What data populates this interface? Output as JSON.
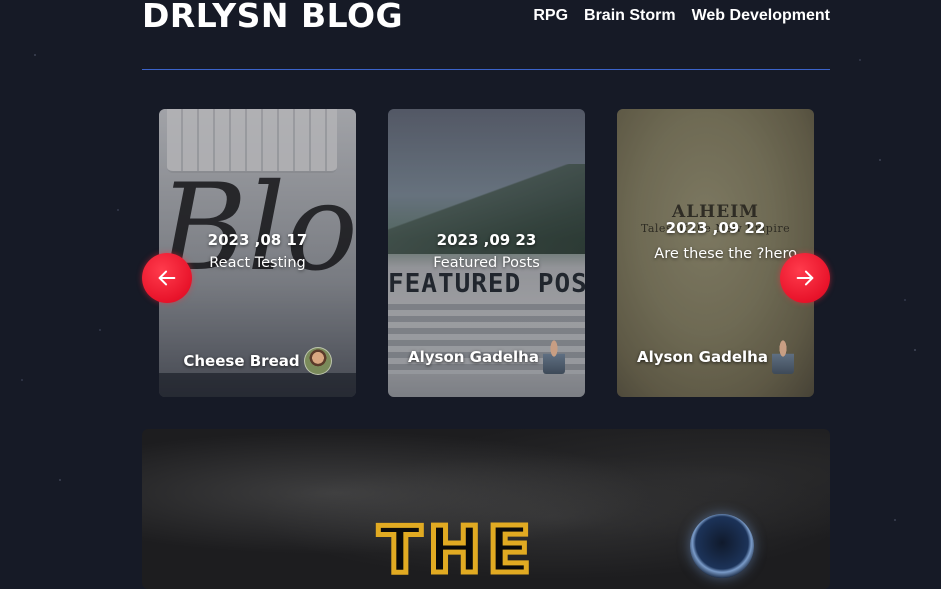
{
  "header": {
    "site_title": "DRLYSN BLOG",
    "nav": [
      {
        "label": "RPG"
      },
      {
        "label": "Brain Storm"
      },
      {
        "label": "Web Development"
      }
    ]
  },
  "carousel": {
    "cards": [
      {
        "date": "2023 ,08 17",
        "title": "React Testing",
        "author": "Cheese Bread",
        "thumbnail_text": "Blog"
      },
      {
        "date": "2023 ,09 23",
        "title": "Featured Posts",
        "author": "Alyson Gadelha",
        "thumbnail_text": "FEATURED POSTS"
      },
      {
        "date": "2023 ,09 22",
        "title": "Are these the ?hero",
        "author": "Alyson Gadelha",
        "thumbnail_text": "ALHEIM",
        "thumbnail_subtext": "Tales of the New Empire"
      }
    ],
    "prev_icon": "arrow-left-icon",
    "next_icon": "arrow-right-icon"
  },
  "banner": {
    "text": "THE"
  },
  "colors": {
    "background": "#161a26",
    "divider": "#3b63c9",
    "arrow_button": "#e8132a",
    "banner_text_stroke": "#e1aa22"
  }
}
